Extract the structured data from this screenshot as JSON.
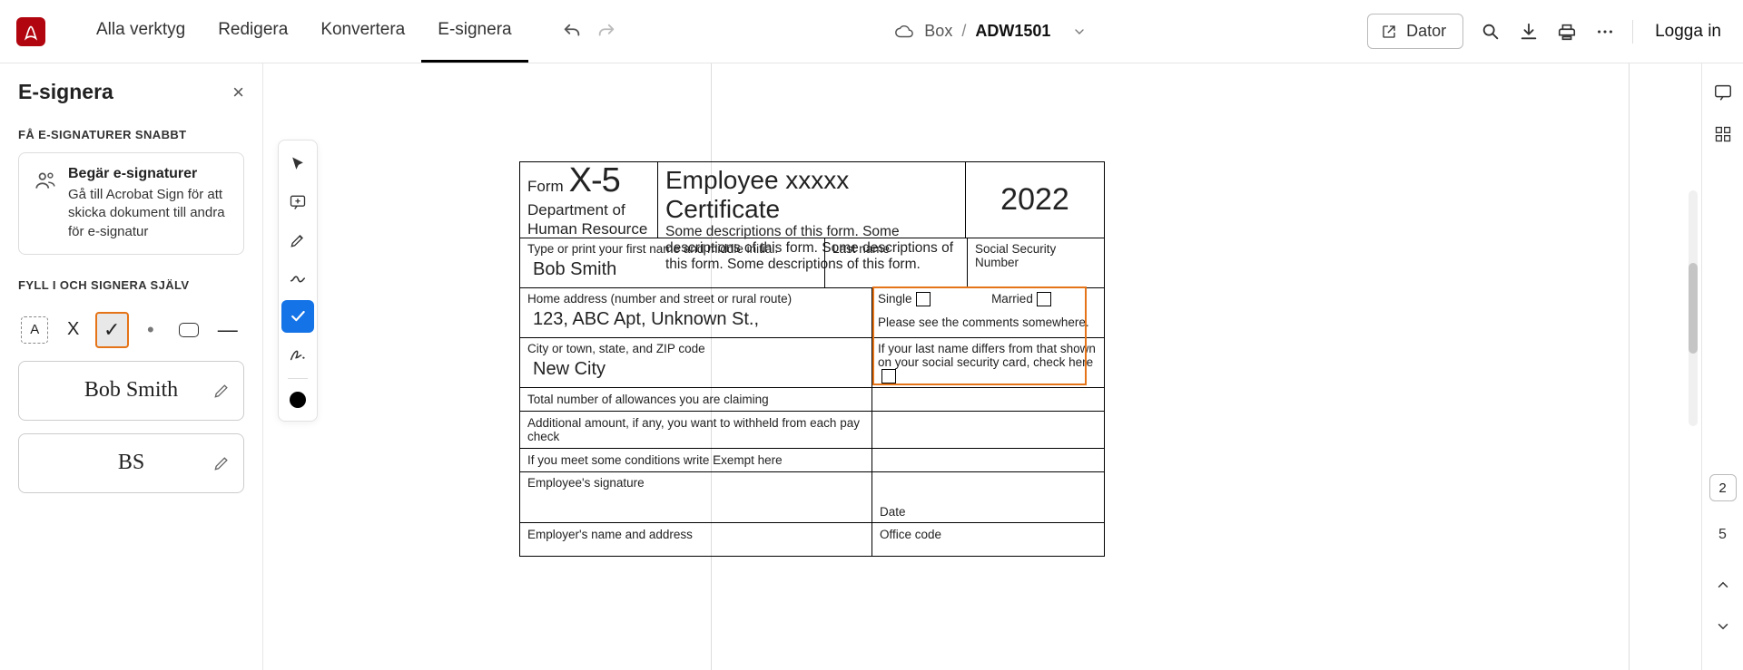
{
  "app": {
    "logo_alt": "Acrobat"
  },
  "tabs": {
    "all_tools": "Alla verktyg",
    "edit": "Redigera",
    "convert": "Konvertera",
    "esign": "E-signera"
  },
  "breadcrumb": {
    "cloud_label": "Box",
    "sep": "/",
    "doc_name": "ADW1501"
  },
  "actions": {
    "dator": "Dator",
    "login": "Logga in"
  },
  "left": {
    "title": "E-signera",
    "section1": "FÅ E-SIGNATURER SNABBT",
    "card_title": "Begär e-signaturer",
    "card_desc": "Gå till Acrobat Sign för att skicka dokument till andra för e-signatur",
    "section2": "FYLL I OCH SIGNERA SJÄLV",
    "signature_text": "Bob Smith",
    "initials_text": "BS"
  },
  "self_tools": {
    "text_a": "A",
    "cross": "X",
    "check": "✓",
    "dot": "•",
    "rect": "▭",
    "line": "—"
  },
  "doc": {
    "form_word": "Form",
    "form_code": "X-5",
    "dept1": "Department of",
    "dept2": "Human Resource",
    "title": "Employee xxxxx Certificate",
    "desc": "Some descriptions of this form. Some descriptions of this form. Some descriptions of this form. Some descriptions of this form.",
    "year": "2022",
    "first_name_label": "Type or print your first name and middle initial.",
    "first_name_value": "Bob Smith",
    "last_name_label": "Last name",
    "ssn_label": "Social Security Number",
    "addr_label": "Home address (number and street or rural route)",
    "addr_value": "123, ABC Apt, Unknown St.,",
    "city_label": "City or town, state, and ZIP code",
    "city_value": "New City",
    "single": "Single",
    "married": "Married",
    "comments_note": "Please see the comments somewhere.",
    "lastname_note": "If your last name differs from that shown on your social security card, check here",
    "allowances": "Total number of allowances you are claiming",
    "additional": "Additional amount, if any, you want to withheld from each pay check",
    "exempt": "If you meet some conditions write Exempt here",
    "emp_sig": "Employee's signature",
    "date": "Date",
    "employer": "Employer's name and address",
    "office": "Office code"
  },
  "pager": {
    "current": "2",
    "total": "5"
  }
}
